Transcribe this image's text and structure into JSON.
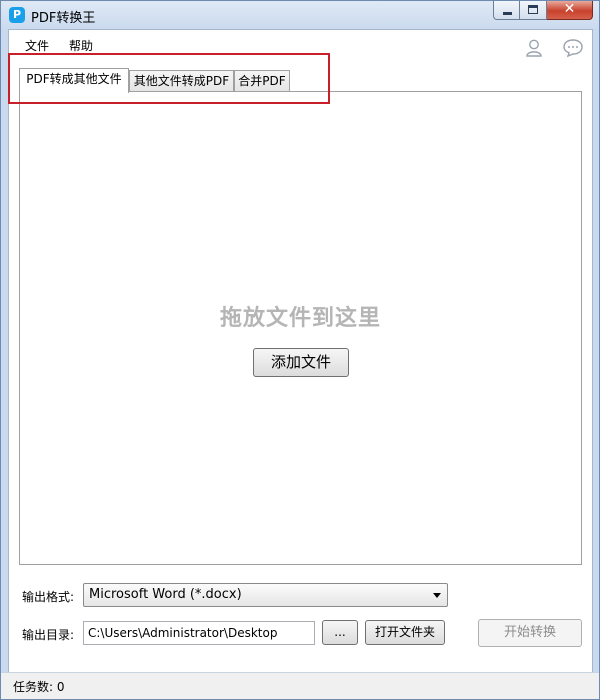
{
  "window": {
    "title": "PDF转换王",
    "app_icon_glyph": "P",
    "buttons": [
      "minimize-icon",
      "maximize-icon",
      "close-icon"
    ]
  },
  "menu": {
    "items": [
      "文件",
      "帮助"
    ],
    "right_icons": [
      "user-icon",
      "chat-icon"
    ]
  },
  "tabs": [
    {
      "label": "PDF转成其他文件",
      "active": true
    },
    {
      "label": "其他文件转成PDF",
      "active": false
    },
    {
      "label": "合并PDF",
      "active": false
    }
  ],
  "dropzone": {
    "hint": "拖放文件到这里",
    "add_button": "添加文件"
  },
  "output": {
    "format_label": "输出格式:",
    "format_value": "Microsoft Word (*.docx)",
    "dir_label": "输出目录:",
    "dir_value": "C:\\Users\\Administrator\\Desktop",
    "browse_label": "...",
    "open_folder_label": "打开文件夹",
    "start_label": "开始转换"
  },
  "status": {
    "text": "任务数: 0"
  },
  "colors": {
    "highlight_box": "#c8202a",
    "app_icon": "#1aa0ea"
  }
}
